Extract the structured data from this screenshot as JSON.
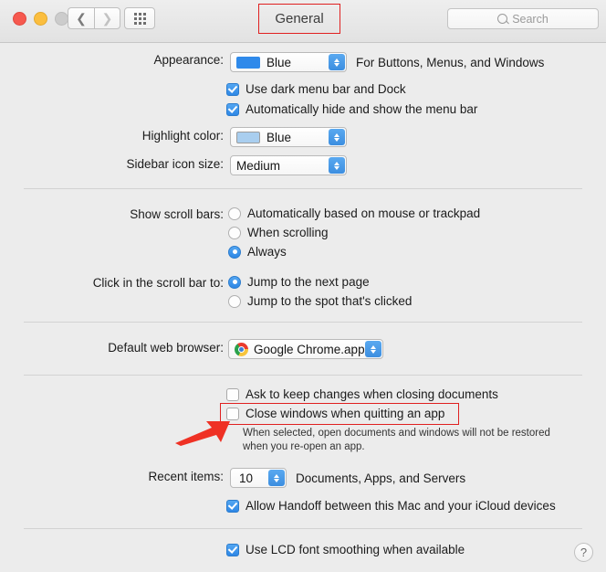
{
  "window": {
    "title": "General",
    "traffic_lights": [
      "close",
      "minimize",
      "zoom"
    ]
  },
  "toolbar": {
    "back_icon": "chevron-left-icon",
    "forward_icon": "chevron-right-icon",
    "show_all_icon": "grid-icon",
    "search": {
      "placeholder": "Search",
      "icon": "search-icon"
    }
  },
  "settings": {
    "appearance": {
      "label": "Appearance:",
      "value": "Blue",
      "swatch_color": "#2f8aea",
      "note": "For Buttons, Menus, and Windows"
    },
    "dark_menu_bar": {
      "label": "Use dark menu bar and Dock",
      "checked": true
    },
    "auto_hide_menu_bar": {
      "label": "Automatically hide and show the menu bar",
      "checked": true
    },
    "highlight_color": {
      "label": "Highlight color:",
      "value": "Blue",
      "swatch_color": "#a9ceef"
    },
    "sidebar_icon_size": {
      "label": "Sidebar icon size:",
      "value": "Medium"
    },
    "show_scroll_bars": {
      "label": "Show scroll bars:",
      "options": [
        {
          "label": "Automatically based on mouse or trackpad",
          "selected": false
        },
        {
          "label": "When scrolling",
          "selected": false
        },
        {
          "label": "Always",
          "selected": true
        }
      ]
    },
    "click_scroll_bar": {
      "label": "Click in the scroll bar to:",
      "options": [
        {
          "label": "Jump to the next page",
          "selected": true
        },
        {
          "label": "Jump to the spot that's clicked",
          "selected": false
        }
      ]
    },
    "default_web_browser": {
      "label": "Default web browser:",
      "value": "Google Chrome.app",
      "icon": "chrome-icon"
    },
    "ask_keep_changes": {
      "label": "Ask to keep changes when closing documents",
      "checked": false
    },
    "close_windows_quitting": {
      "label": "Close windows when quitting an app",
      "checked": false,
      "hint_line1": "When selected, open documents and windows will not be restored",
      "hint_line2": "when you re-open an app.",
      "highlighted": true
    },
    "recent_items": {
      "label": "Recent items:",
      "value": "10",
      "note": "Documents, Apps, and Servers"
    },
    "handoff": {
      "label": "Allow Handoff between this Mac and your iCloud devices",
      "checked": true
    },
    "lcd_font_smoothing": {
      "label": "Use LCD font smoothing when available",
      "checked": true
    }
  },
  "help": {
    "label": "?"
  },
  "annotations": {
    "highlight_color": "#e02020",
    "title_box": true,
    "checkbox_box": true,
    "arrow": true
  }
}
